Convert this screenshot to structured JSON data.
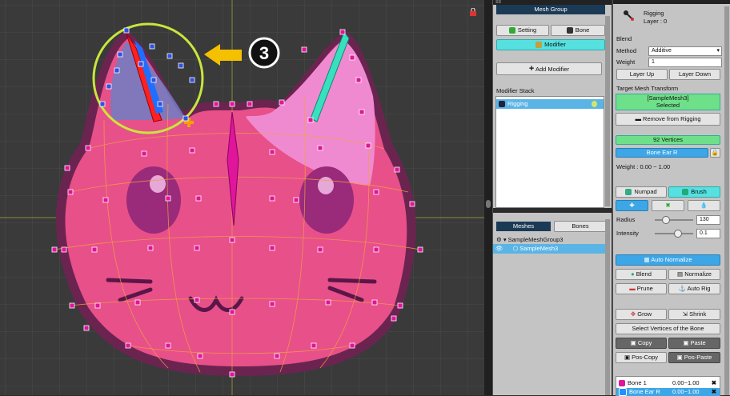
{
  "viewport": {
    "step_badge": "3",
    "colors": {
      "grid_bg": "#3a3a3a",
      "mesh_fill": "#e8508a",
      "vertex": "#e0159b",
      "highlight_ring": "#c8e63c",
      "arrow": "#f5c000"
    }
  },
  "mesh_group": {
    "title": "Mesh Group",
    "tabs": {
      "setting": "Setting",
      "bone": "Bone"
    },
    "modifier_tab": "Modifier",
    "add_modifier": "Add Modifier",
    "modifier_stack_label": "Modifier Stack",
    "modifiers": [
      {
        "name": "Rigging"
      }
    ]
  },
  "meshes_panel": {
    "tabs": {
      "meshes": "Meshes",
      "bones": "Bones"
    },
    "tree": [
      {
        "name": "SampleMeshGroup3"
      },
      {
        "name": "SampleMesh3"
      }
    ]
  },
  "rigging": {
    "title": "Rigging",
    "layer": "Layer : 0",
    "blend_label": "Blend",
    "method_label": "Method",
    "method_value": "Additive",
    "weight_label": "Weight",
    "weight_value": "1",
    "layer_up": "Layer Up",
    "layer_down": "Layer Down",
    "target_label": "Target Mesh Transform",
    "target_name": "[SampleMesh3]",
    "target_status": "Selected",
    "remove_button": "Remove from Rigging",
    "vertex_count": "92 Vertices",
    "bone_name": "Bone Ear R",
    "weight_range": "Weight : 0.00 ~ 1.00",
    "numpad": "Numpad",
    "brush": "Brush",
    "radius_label": "Radius",
    "radius_value": "130",
    "intensity_label": "Intensity",
    "intensity_value": "0.1",
    "auto_normalize": "Auto Normalize",
    "blend_btn": "Blend",
    "normalize_btn": "Normalize",
    "prune_btn": "Prune",
    "auto_rig_btn": "Auto Rig",
    "grow_btn": "Grow",
    "shrink_btn": "Shrink",
    "select_vertices_btn": "Select Vertices of the Bone",
    "copy_btn": "Copy",
    "paste_btn": "Paste",
    "pos_copy_btn": "Pos-Copy",
    "pos_paste_btn": "Pos-Paste",
    "bones": [
      {
        "name": "Bone 1",
        "range": "0.00~1.00",
        "color": "#e0159b"
      },
      {
        "name": "Bone Ear R",
        "range": "0.00~1.00",
        "color": "#1e90ff"
      }
    ]
  }
}
